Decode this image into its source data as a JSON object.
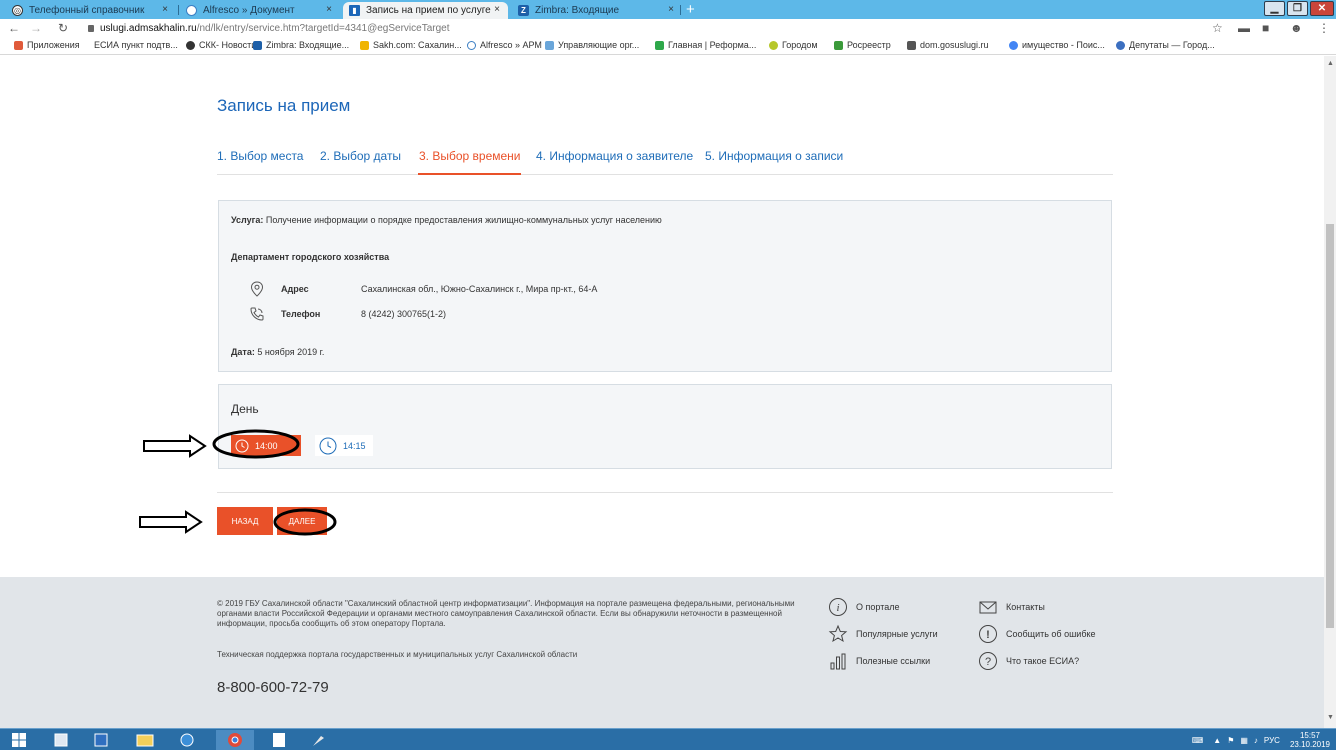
{
  "browser": {
    "tabs": [
      {
        "title": "Телефонный справочник",
        "close": "×"
      },
      {
        "title": "Alfresco » Документ",
        "close": "×"
      },
      {
        "title": "Запись на прием по услуге",
        "close": "×"
      },
      {
        "title": "Zimbra: Входящие",
        "close": "×"
      }
    ],
    "new_tab": "+",
    "url_host": "uslugi.admsakhalin.ru",
    "url_path": "/nd/lk/entry/service.htm?targetId=4341@egServiceTarget",
    "bookmarks": [
      "Приложения",
      "ЕСИА пункт подтв...",
      "СКК- Новости",
      "Zimbra: Входящие...",
      "Sakh.com: Сахалин...",
      "Alfresco » АРМ",
      "Управляющие орг...",
      "Главная | Реформа...",
      "Городом",
      "Росреестр",
      "dom.gosuslugi.ru",
      "имущество - Поис...",
      "Депутаты — Город..."
    ]
  },
  "page": {
    "title": "Запись на прием",
    "steps": [
      "1. Выбор места",
      "2. Выбор даты",
      "3. Выбор времени",
      "4. Информация о заявителе",
      "5. Информация о записи"
    ],
    "service_label": "Услуга:",
    "service_value": " Получение информации о порядке предоставления жилищно-коммунальных услуг населению",
    "department": "Департамент городского хозяйства",
    "address_label": "Адрес",
    "address_value": "Сахалинская обл., Южно-Сахалинск г., Мира пр-кт., 64-А",
    "phone_label": "Телефон",
    "phone_value": "8 (4242) 300765(1-2)",
    "date_label": "Дата:",
    "date_value": " 5 ноября 2019 г.",
    "day_title": "День",
    "slots": [
      "14:00",
      "14:15"
    ],
    "back_button": "НАЗАД",
    "next_button": "ДАЛЕЕ"
  },
  "footer": {
    "copyright": "© 2019 ГБУ Сахалинской области \"Сахалинский областной центр информатизации\". Информация на портале размещена федеральными, региональными органами власти Российской Федерации и органами местного самоуправления Сахалинской области. Если вы обнаружили неточности в размещенной информации, просьба сообщить об этом оператору Портала.",
    "support": "Техническая поддержка портала государственных и муниципальных услуг Сахалинской области",
    "phone": "8-800-600-72-79",
    "links": [
      "О портале",
      "Популярные услуги",
      "Полезные ссылки",
      "Контакты",
      "Сообщить об ошибке",
      "Что такое ЕСИА?"
    ]
  },
  "taskbar": {
    "lang": "РУС",
    "time": "15:57",
    "date": "23.10.2019"
  },
  "colors": {
    "accent": "#e95129",
    "link": "#1f6db8",
    "tabstrip": "#5db8e8",
    "taskbar": "#2a6ea6"
  }
}
